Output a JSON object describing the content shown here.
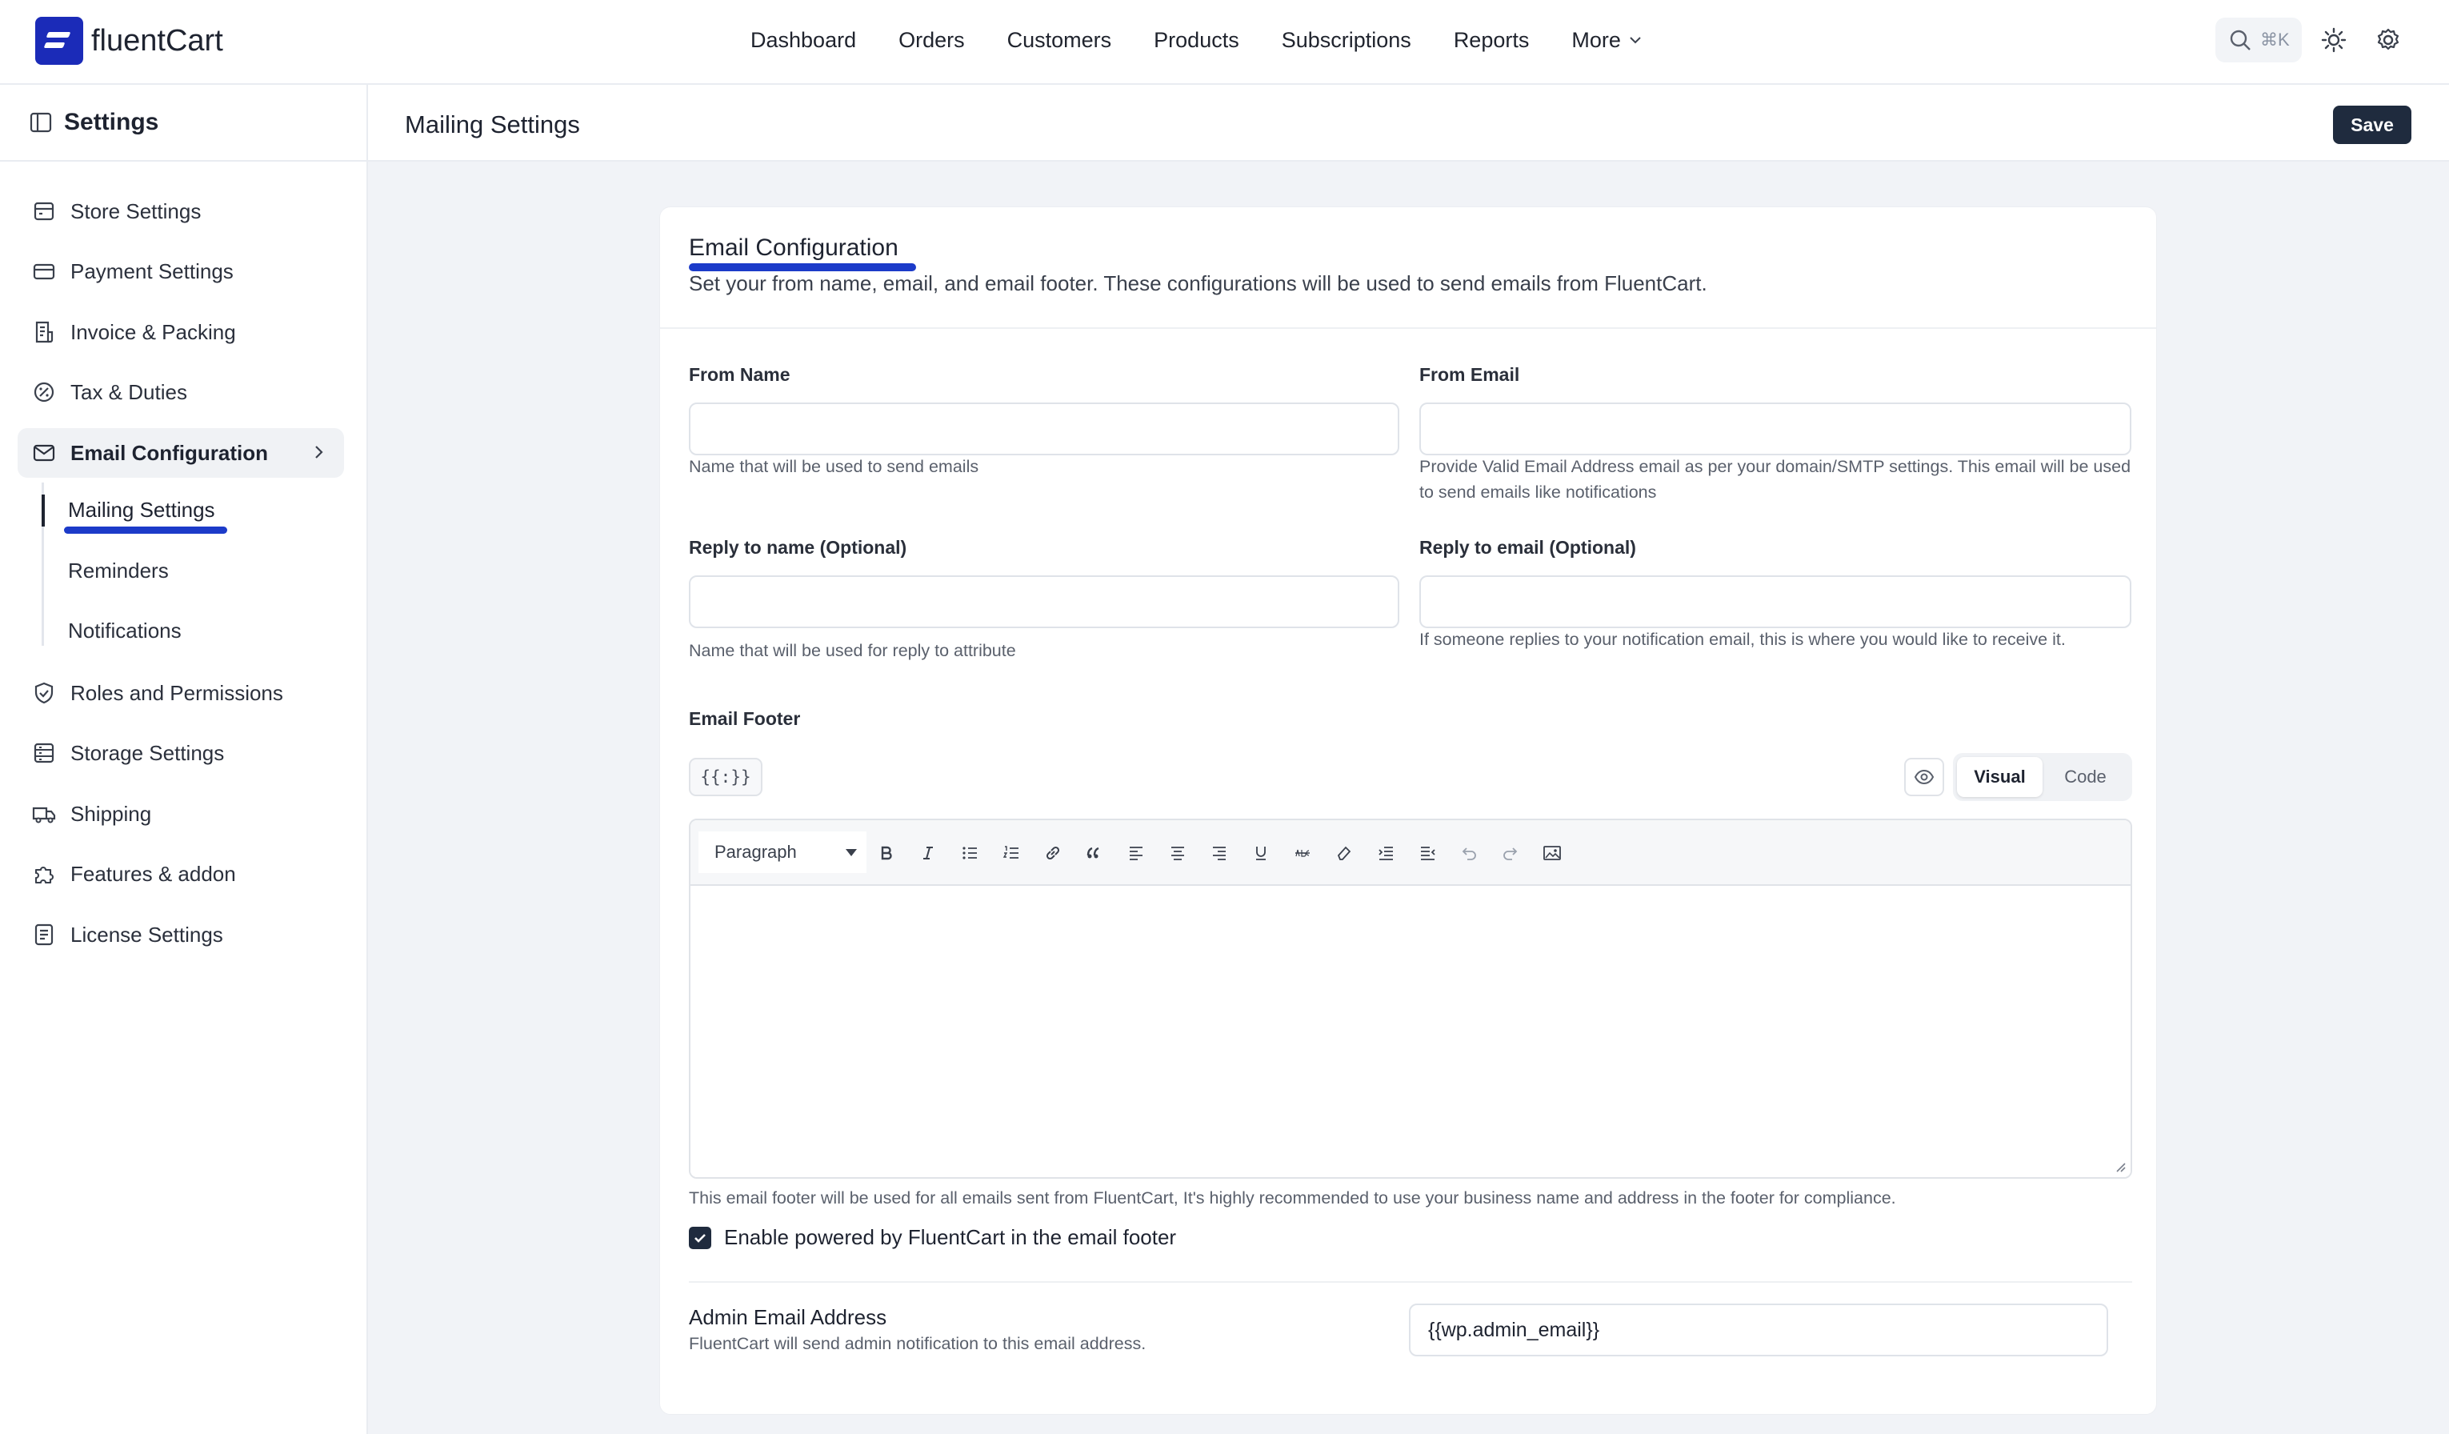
{
  "brand": {
    "name_prefix": "fluent",
    "name_suffix": "Cart"
  },
  "nav": {
    "items": [
      "Dashboard",
      "Orders",
      "Customers",
      "Products",
      "Subscriptions",
      "Reports"
    ],
    "more_label": "More"
  },
  "search": {
    "shortcut": "⌘K"
  },
  "sidebar": {
    "title": "Settings",
    "items": [
      {
        "label": "Store Settings",
        "icon": "store-icon"
      },
      {
        "label": "Payment Settings",
        "icon": "card-icon"
      },
      {
        "label": "Invoice & Packing",
        "icon": "invoice-icon"
      },
      {
        "label": "Tax & Duties",
        "icon": "percent-icon"
      },
      {
        "label": "Email Configuration",
        "icon": "mail-icon"
      },
      {
        "label": "Roles and Permissions",
        "icon": "shield-icon"
      },
      {
        "label": "Storage Settings",
        "icon": "storage-icon"
      },
      {
        "label": "Shipping",
        "icon": "truck-icon"
      },
      {
        "label": "Features & addon",
        "icon": "puzzle-icon"
      },
      {
        "label": "License Settings",
        "icon": "license-icon"
      }
    ],
    "sub_items": [
      "Mailing Settings",
      "Reminders",
      "Notifications"
    ]
  },
  "page": {
    "title": "Mailing Settings",
    "save_label": "Save"
  },
  "card": {
    "title": "Email Configuration",
    "description": "Set your from name, email, and email footer. These configurations will be used to send emails from FluentCart."
  },
  "form": {
    "from_name": {
      "label": "From Name",
      "value": "",
      "hint": "Name that will be used to send emails"
    },
    "from_email": {
      "label": "From Email",
      "value": "",
      "hint": "Provide Valid Email Address email as per your domain/SMTP settings. This email will be used to send emails like notifications"
    },
    "reply_name": {
      "label": "Reply to name (Optional)",
      "value": "",
      "hint": "Name that will be used for reply to attribute"
    },
    "reply_email": {
      "label": "Reply to email (Optional)",
      "value": "",
      "hint": "If someone replies to your notification email, this is where you would like to receive it."
    },
    "footer": {
      "label": "Email Footer",
      "template_btn": "{{:}}",
      "mode_visual": "Visual",
      "mode_code": "Code",
      "format": "Paragraph",
      "hint": "This email footer will be used for all emails sent from FluentCart, It's highly recommended to use your business name and address in the footer for compliance."
    },
    "powered_by": {
      "label": "Enable powered by FluentCart in the email footer",
      "checked": true
    },
    "admin_email": {
      "title": "Admin Email Address",
      "description": "FluentCart will send admin notification to this email address.",
      "value": "{{wp.admin_email}}"
    }
  },
  "colors": {
    "accent": "#1c3bc9",
    "brand": "#1b2bb8",
    "dark_button": "#1f2b3e"
  }
}
